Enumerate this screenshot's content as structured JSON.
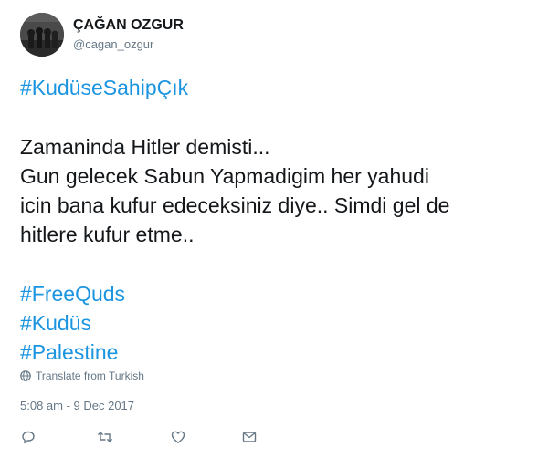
{
  "user": {
    "display_name": "ÇAĞAN OZGUR",
    "handle": "@cagan_ozgur"
  },
  "tweet": {
    "lines": [
      "#KudüseSahipÇık",
      "",
      "Zamaninda Hitler demisti...",
      "Gun gelecek Sabun Yapmadigim her yahudi",
      "icin bana kufur edeceksiniz diye.. Simdi gel de",
      "hitlere kufur etme..",
      "",
      "#FreeQuds",
      "#Kudüs",
      "#Palestine"
    ],
    "translate_label": "Translate from Turkish",
    "timestamp": "5:08 am - 9 Dec 2017"
  },
  "actions": {
    "icons": [
      "reply-icon",
      "retweet-icon",
      "like-icon",
      "share-icon"
    ]
  },
  "colors": {
    "hashtag": "#1b95e0",
    "text": "#14171a",
    "secondary": "#657786"
  }
}
